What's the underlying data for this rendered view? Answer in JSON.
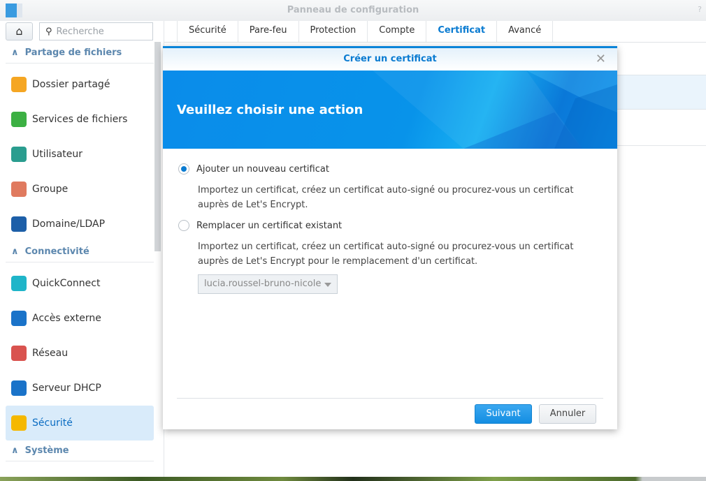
{
  "window": {
    "title": "Panneau de configuration",
    "help": "?"
  },
  "search": {
    "placeholder": "Recherche"
  },
  "sidebar": {
    "sections": [
      {
        "label": "Partage de fichiers",
        "items": [
          {
            "label": "Dossier partagé",
            "icon": "shared-folder-icon",
            "color": "#f5a623"
          },
          {
            "label": "Services de fichiers",
            "icon": "file-services-icon",
            "color": "#3cb043"
          },
          {
            "label": "Utilisateur",
            "icon": "user-icon",
            "color": "#2a9d8f"
          },
          {
            "label": "Groupe",
            "icon": "group-icon",
            "color": "#e07a5f"
          },
          {
            "label": "Domaine/LDAP",
            "icon": "domain-icon",
            "color": "#1d5fa8"
          }
        ]
      },
      {
        "label": "Connectivité",
        "items": [
          {
            "label": "QuickConnect",
            "icon": "quickconnect-icon",
            "color": "#1fb5c9"
          },
          {
            "label": "Accès externe",
            "icon": "globe-icon",
            "color": "#1a73c9"
          },
          {
            "label": "Réseau",
            "icon": "network-home-icon",
            "color": "#d9534f"
          },
          {
            "label": "Serveur DHCP",
            "icon": "dhcp-icon",
            "color": "#1a73c9"
          },
          {
            "label": "Sécurité",
            "icon": "shield-icon",
            "color": "#f5b800",
            "active": true
          }
        ]
      },
      {
        "label": "Système",
        "items": []
      }
    ]
  },
  "tabs": [
    {
      "label": "Sécurité"
    },
    {
      "label": "Pare-feu"
    },
    {
      "label": "Protection"
    },
    {
      "label": "Compte"
    },
    {
      "label": "Certificat",
      "active": true
    },
    {
      "label": "Avancé"
    }
  ],
  "dialog": {
    "title": "Créer un certificat",
    "heading": "Veuillez choisir une action",
    "options": [
      {
        "label": "Ajouter un nouveau certificat",
        "selected": true,
        "description": "Importez un certificat, créez un certificat auto-signé ou procurez-vous un certificat auprès de Let's Encrypt."
      },
      {
        "label": "Remplacer un certificat existant",
        "selected": false,
        "description": "Importez un certificat, créez un certificat auto-signé ou procurez-vous un certificat auprès de Let's Encrypt pour le remplacement d'un certificat."
      }
    ],
    "certificate_select": "lucia.roussel-bruno-nicole",
    "next": "Suivant",
    "cancel": "Annuler"
  },
  "colors": {
    "accent": "#0a7bd1",
    "banner": "#0a8cea"
  }
}
